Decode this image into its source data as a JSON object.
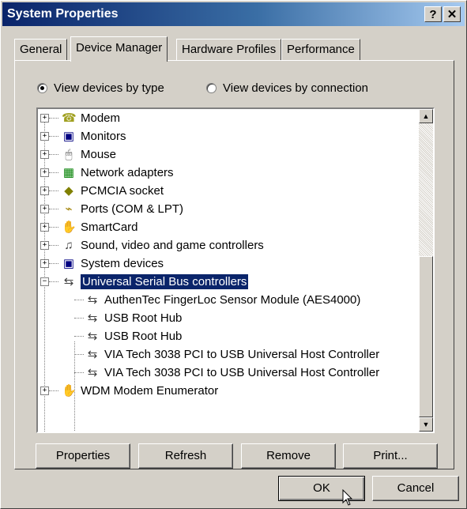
{
  "window": {
    "title": "System Properties",
    "help_glyph": "?",
    "close_glyph": "✕"
  },
  "tabs": [
    {
      "label": "General"
    },
    {
      "label": "Device Manager"
    },
    {
      "label": "Hardware Profiles"
    },
    {
      "label": "Performance"
    }
  ],
  "view_options": {
    "by_type": "View devices by type",
    "by_connection": "View devices by connection",
    "selected": "by_type"
  },
  "tree": {
    "items": [
      {
        "label": "Modem",
        "icon": "modem-icon",
        "expander": "+"
      },
      {
        "label": "Monitors",
        "icon": "monitor-icon",
        "expander": "+"
      },
      {
        "label": "Mouse",
        "icon": "mouse-icon",
        "expander": "+"
      },
      {
        "label": "Network adapters",
        "icon": "network-adapter-icon",
        "expander": "+"
      },
      {
        "label": "PCMCIA socket",
        "icon": "pcmcia-icon",
        "expander": "+"
      },
      {
        "label": "Ports (COM & LPT)",
        "icon": "port-icon",
        "expander": "+"
      },
      {
        "label": "SmartCard",
        "icon": "smartcard-icon",
        "expander": "+"
      },
      {
        "label": "Sound, video and game controllers",
        "icon": "sound-icon",
        "expander": "+"
      },
      {
        "label": "System devices",
        "icon": "computer-icon",
        "expander": "+"
      },
      {
        "label": "Universal Serial Bus controllers",
        "icon": "usb-icon",
        "expander": "−"
      }
    ],
    "usb_children": [
      "AuthenTec FingerLoc Sensor Module (AES4000)",
      "USB Root Hub",
      "USB Root Hub",
      "VIA Tech 3038 PCI to USB Universal Host Controller",
      "VIA Tech 3038 PCI to USB Universal Host Controller"
    ],
    "last_item": {
      "label": "WDM Modem Enumerator",
      "icon": "smartcard-icon",
      "expander": "+"
    },
    "selected_item": "Universal Serial Bus controllers"
  },
  "buttons": {
    "properties": "Properties",
    "refresh": "Refresh",
    "remove": "Remove",
    "print": "Print...",
    "ok": "OK",
    "cancel": "Cancel"
  },
  "scrollbar": {
    "up_glyph": "▲",
    "down_glyph": "▼"
  }
}
